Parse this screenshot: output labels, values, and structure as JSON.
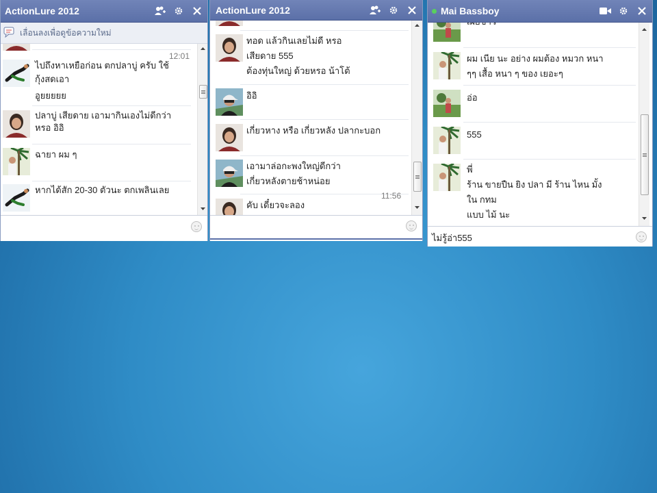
{
  "windows": [
    {
      "title": "ActionLure 2012",
      "notice": "เลื่อนลงเพื่อดูข้อความใหม่",
      "timestamp": "12:01",
      "messages": [
        {
          "lines": [
            "ไปถึงหาเหยือก่อน ตกปลาบู่ ครับ ใช้",
            "กุ้งสดเอา",
            "อูยยยยย"
          ],
          "avatar": "diver"
        },
        {
          "lines": [
            "ปลาบู่ เสียดาย เอามากินเองไม่ดีกว่า",
            "หรอ อิอิ"
          ],
          "avatar": "woman"
        },
        {
          "lines": [
            "ฉายา ผม ๆ"
          ],
          "avatar": "man-palm"
        },
        {
          "lines": [
            "หากได้สัก 20-30 ตัวนะ ตกเพลินเลย"
          ],
          "avatar": "diver"
        }
      ],
      "input_value": ""
    },
    {
      "title": "ActionLure 2012",
      "timestamp": "11:56",
      "messages": [
        {
          "lines": [
            "ทอด แล้วกินเลยไม่ดี หรอ",
            "เสียดาย 555",
            "ต้องทุ่นใหญ่ ด้วยหรอ น้าโต้"
          ],
          "avatar": "woman"
        },
        {
          "lines": [
            "อิอิ"
          ],
          "avatar": "man-cap"
        },
        {
          "lines": [
            "เกี่ยวหาง หรือ เกี่ยวหลัง ปลากะบอก"
          ],
          "avatar": "woman"
        },
        {
          "lines": [
            "เอามาล่อกะพงใหญ่ดีกว่า",
            "เกี่ยวหลังตายช้าหน่อย"
          ],
          "avatar": "man-cap"
        },
        {
          "lines": [
            "คับ เดี๋ยวจะลอง"
          ],
          "avatar": "woman"
        }
      ],
      "input_value": ""
    },
    {
      "title": "Mai Bassboy",
      "status_color": "#59d05e",
      "messages": [
        {
          "lines": [
            "เผยข่าว"
          ],
          "avatar": "man-outdoor"
        },
        {
          "lines": [
            "ผม เนีย นะ อย่าง ผมต้อง หมวก หนา",
            "ๆๆ เสื้อ หนา ๆ  ของ เยอะๆ"
          ],
          "avatar": "man-palm"
        },
        {
          "lines": [
            "อ่อ"
          ],
          "avatar": "man-outdoor"
        },
        {
          "lines": [
            "555"
          ],
          "avatar": "man-palm"
        },
        {
          "lines": [
            "พี่",
            "ร้าน ขายปืน ยิง ปลา มี ร้าน ไหน มั้ง",
            "ใน กทม",
            "แบบ ไม้ นะ"
          ],
          "avatar": "man-palm"
        }
      ],
      "input_value": "ไม่รู้อ่า555"
    }
  ],
  "icons": {
    "add_friends": "add-friends-icon",
    "settings": "gear-icon",
    "close": "close-icon",
    "video": "video-call-icon",
    "notice": "chat-bubble-icon",
    "emoticon": "smiley-icon"
  },
  "colors": {
    "header": "#5b70a8",
    "desktop": "#3a96d2",
    "online": "#59d05e"
  }
}
